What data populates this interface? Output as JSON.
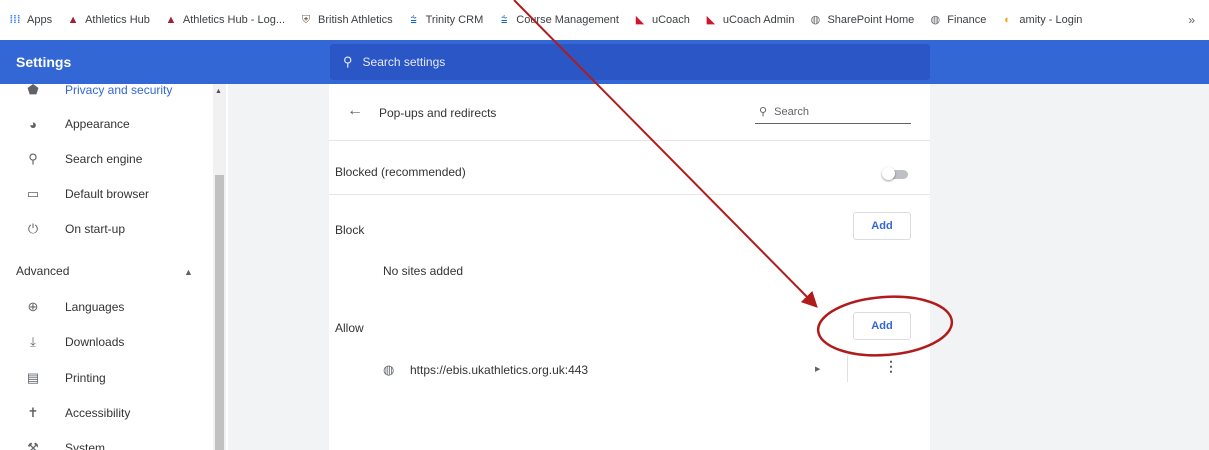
{
  "bookmarks": {
    "items": [
      {
        "label": "Apps",
        "icon": "apps-grid-icon",
        "color": "#4285f4"
      },
      {
        "label": "Athletics Hub",
        "icon": "athletics-hub-logo-icon",
        "color": "#a31f34"
      },
      {
        "label": "Athletics Hub - Log...",
        "icon": "athletics-hub-logo-icon",
        "color": "#a31f34"
      },
      {
        "label": "British Athletics",
        "icon": "british-athletics-logo-icon",
        "color": "#7a6a55"
      },
      {
        "label": "Trinity CRM",
        "icon": "trinity-logo-icon",
        "color": "#1565c0"
      },
      {
        "label": "Course Management",
        "icon": "trinity-logo-icon",
        "color": "#1565c0"
      },
      {
        "label": "uCoach",
        "icon": "ucoach-flag-icon",
        "color": "#cf142b"
      },
      {
        "label": "uCoach Admin",
        "icon": "ucoach-flag-icon",
        "color": "#cf142b"
      },
      {
        "label": "SharePoint Home",
        "icon": "globe-icon",
        "color": "#5f6368"
      },
      {
        "label": "Finance",
        "icon": "globe-icon",
        "color": "#5f6368"
      },
      {
        "label": "amity - Login",
        "icon": "amity-logo-icon",
        "color": "#f5a623"
      }
    ],
    "more": "»"
  },
  "header": {
    "title": "Settings",
    "search_placeholder": "Search settings",
    "color": "#3367d6"
  },
  "sidebar": {
    "items_top": [
      {
        "label": "Privacy and security",
        "icon": "shield-icon",
        "glyph": "⬤"
      },
      {
        "label": "Appearance",
        "icon": "palette-icon",
        "glyph": "🎨"
      },
      {
        "label": "Search engine",
        "icon": "search-icon",
        "glyph": "⚲"
      },
      {
        "label": "Default browser",
        "icon": "browser-window-icon",
        "glyph": "▭"
      },
      {
        "label": "On start-up",
        "icon": "power-icon",
        "glyph": "⏻"
      }
    ],
    "advanced_label": "Advanced",
    "items_advanced": [
      {
        "label": "Languages",
        "icon": "globe-icon",
        "glyph": "⊕"
      },
      {
        "label": "Downloads",
        "icon": "download-icon",
        "glyph": "⤓"
      },
      {
        "label": "Printing",
        "icon": "printer-icon",
        "glyph": "🖶"
      },
      {
        "label": "Accessibility",
        "icon": "accessibility-icon",
        "glyph": "✝"
      },
      {
        "label": "System",
        "icon": "wrench-icon",
        "glyph": "🔧"
      }
    ]
  },
  "main": {
    "page_title": "Pop-ups and redirects",
    "search_label": "Search",
    "blocked_label": "Blocked (recommended)",
    "blocked_toggle_on": false,
    "block_section": "Block",
    "block_add": "Add",
    "block_empty": "No sites added",
    "allow_section": "Allow",
    "allow_add": "Add",
    "allow_sites": [
      "https://ebis.ukathletics.org.uk:443"
    ]
  },
  "annotation": {
    "color": "#b01c1c"
  }
}
